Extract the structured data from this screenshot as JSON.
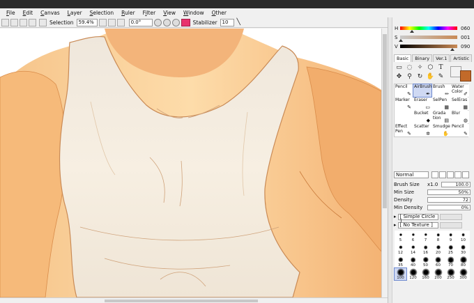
{
  "menu": [
    "File",
    "Edit",
    "Canvas",
    "Layer",
    "Selection",
    "Ruler",
    "Filter",
    "View",
    "Window",
    "Other"
  ],
  "menu_underline": [
    "F",
    "E",
    "C",
    "L",
    "S",
    "R",
    "i",
    "V",
    "W",
    "O"
  ],
  "toolbar": {
    "selection_label": "Selection",
    "zoom": "59.4%",
    "angle": "0.0°",
    "stabilizer_label": "Stabilizer",
    "stabilizer_value": "10"
  },
  "color": {
    "h_label": "H",
    "h_value": "060",
    "s_label": "S",
    "s_value": "001",
    "v_label": "V",
    "v_value": "090",
    "tabs": [
      "Basic",
      "Binary",
      "Ver.1",
      "Artistic"
    ],
    "fg": "#f2f2f2",
    "bg": "#c26a2a"
  },
  "brushes": [
    {
      "label": "Pencil",
      "icon": "✎"
    },
    {
      "label": "AirBrush",
      "icon": "✒"
    },
    {
      "label": "Brush",
      "icon": "✏"
    },
    {
      "label": "Water Color",
      "icon": "✐"
    },
    {
      "label": "Marker",
      "icon": "✎"
    },
    {
      "label": "Eraser",
      "icon": "▭"
    },
    {
      "label": "SelPen",
      "icon": "▦"
    },
    {
      "label": "SelEras",
      "icon": "▦"
    },
    {
      "label": "",
      "icon": ""
    },
    {
      "label": "Bucket",
      "icon": "◆"
    },
    {
      "label": "Grada tion",
      "icon": "▤"
    },
    {
      "label": "Blur",
      "icon": "◍"
    },
    {
      "label": "Effect Pen",
      "icon": "✎"
    },
    {
      "label": "Scatter",
      "icon": "✲"
    },
    {
      "label": "Smudge",
      "icon": "✋"
    },
    {
      "label": "Pencil",
      "icon": "✎"
    }
  ],
  "brush_selected_index": 1,
  "blend_mode": "Normal",
  "params": {
    "brush_size_label": "Brush Size",
    "brush_size_mult": "x1.0",
    "brush_size_value": "100.0",
    "min_size_label": "Min Size",
    "min_size_value": "50%",
    "density_label": "Density",
    "density_value": "72",
    "min_density_label": "Min Density",
    "min_density_value": "0%"
  },
  "brush_shape": "[ Simple Circle ]",
  "texture": "[ No Texture ]",
  "brush_sizes": [
    "5",
    "6",
    "7",
    "8",
    "9",
    "10",
    "12",
    "14",
    "16",
    "20",
    "25",
    "30",
    "35",
    "40",
    "50",
    "60",
    "70",
    "80",
    "100",
    "120",
    "160",
    "200",
    "250",
    "300"
  ],
  "brush_size_selected": "100"
}
